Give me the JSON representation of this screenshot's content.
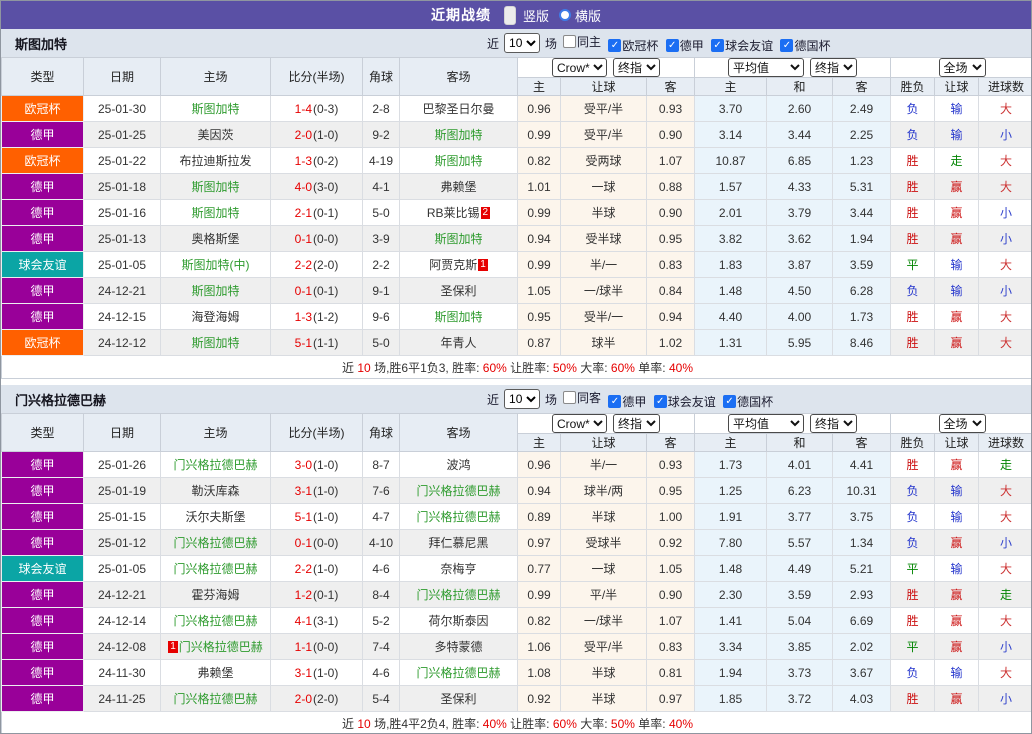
{
  "topbar": {
    "title": "近期战绩",
    "radios": [
      {
        "label": "竖版",
        "selected": true
      },
      {
        "label": "横版",
        "selected": false
      }
    ]
  },
  "table_headers": {
    "left": [
      "类型",
      "日期",
      "主场",
      "比分(半场)",
      "角球",
      "客场"
    ],
    "sub": [
      "主",
      "让球",
      "客",
      "主",
      "和",
      "客",
      "胜负",
      "让球",
      "进球数"
    ],
    "selects": {
      "odds": "Crow*",
      "odds_final": "终指",
      "avg": "平均值",
      "avg_final": "终指",
      "full": "全场"
    }
  },
  "filter_labels": {
    "near": "近",
    "unit": "场"
  },
  "result_colors": {
    "胜": "#cc1111",
    "赢": "#cc1111",
    "大": "#cc3333",
    "负": "#2233cc",
    "输": "#2233cc",
    "小": "#3344cc",
    "平": "#028402",
    "走": "#028402"
  },
  "league_colors": {
    "欧冠杯": "#ff6000",
    "德甲": "#990099",
    "球会友谊": "#0ba5a5"
  },
  "accent_colors": {
    "focus_team_green": "#2e9b2e",
    "score_red": "#e60000",
    "topbar_purple": "#5a50a5",
    "checkbox_blue": "#1b6ef3"
  },
  "sections": [
    {
      "team": "斯图加特",
      "filter": {
        "matches": "10",
        "checkboxes": [
          {
            "label": "同主",
            "checked": false
          },
          {
            "label": "欧冠杯",
            "checked": true
          },
          {
            "label": "德甲",
            "checked": true
          },
          {
            "label": "球会友谊",
            "checked": true
          },
          {
            "label": "德国杯",
            "checked": true
          }
        ]
      },
      "rows": [
        {
          "type": "欧冠杯",
          "type_color": "#ff6000",
          "date": "25-01-30",
          "home": "斯图加特",
          "home_focus": true,
          "home_card": "",
          "score": "1-4",
          "half": "(0-3)",
          "corners": "2-8",
          "away": "巴黎圣日尔曼",
          "away_focus": false,
          "away_card": "",
          "o1": "0.96",
          "line": "受平/半",
          "o2": "0.93",
          "m1": "3.70",
          "m2": "2.60",
          "m3": "2.49",
          "r1": "负",
          "r2": "输",
          "r3": "大"
        },
        {
          "type": "德甲",
          "type_color": "#990099",
          "date": "25-01-25",
          "home": "美因茨",
          "home_focus": false,
          "home_card": "",
          "score": "2-0",
          "half": "(1-0)",
          "corners": "9-2",
          "away": "斯图加特",
          "away_focus": true,
          "away_card": "",
          "o1": "0.99",
          "line": "受平/半",
          "o2": "0.90",
          "m1": "3.14",
          "m2": "3.44",
          "m3": "2.25",
          "r1": "负",
          "r2": "输",
          "r3": "小"
        },
        {
          "type": "欧冠杯",
          "type_color": "#ff6000",
          "date": "25-01-22",
          "home": "布拉迪斯拉发",
          "home_focus": false,
          "home_card": "",
          "score": "1-3",
          "half": "(0-2)",
          "corners": "4-19",
          "away": "斯图加特",
          "away_focus": true,
          "away_card": "",
          "o1": "0.82",
          "line": "受两球",
          "o2": "1.07",
          "m1": "10.87",
          "m2": "6.85",
          "m3": "1.23",
          "r1": "胜",
          "r2": "走",
          "r3": "大"
        },
        {
          "type": "德甲",
          "type_color": "#990099",
          "date": "25-01-18",
          "home": "斯图加特",
          "home_focus": true,
          "home_card": "",
          "score": "4-0",
          "half": "(3-0)",
          "corners": "4-1",
          "away": "弗赖堡",
          "away_focus": false,
          "away_card": "",
          "o1": "1.01",
          "line": "一球",
          "o2": "0.88",
          "m1": "1.57",
          "m2": "4.33",
          "m3": "5.31",
          "r1": "胜",
          "r2": "赢",
          "r3": "大"
        },
        {
          "type": "德甲",
          "type_color": "#990099",
          "date": "25-01-16",
          "home": "斯图加特",
          "home_focus": true,
          "home_card": "",
          "score": "2-1",
          "half": "(0-1)",
          "corners": "5-0",
          "away": "RB莱比锡",
          "away_focus": false,
          "away_card": "2",
          "o1": "0.99",
          "line": "半球",
          "o2": "0.90",
          "m1": "2.01",
          "m2": "3.79",
          "m3": "3.44",
          "r1": "胜",
          "r2": "赢",
          "r3": "小"
        },
        {
          "type": "德甲",
          "type_color": "#990099",
          "date": "25-01-13",
          "home": "奥格斯堡",
          "home_focus": false,
          "home_card": "",
          "score": "0-1",
          "half": "(0-0)",
          "corners": "3-9",
          "away": "斯图加特",
          "away_focus": true,
          "away_card": "",
          "o1": "0.94",
          "line": "受半球",
          "o2": "0.95",
          "m1": "3.82",
          "m2": "3.62",
          "m3": "1.94",
          "r1": "胜",
          "r2": "赢",
          "r3": "小"
        },
        {
          "type": "球会友谊",
          "type_color": "#0ba5a5",
          "date": "25-01-05",
          "home": "斯图加特(中)",
          "home_focus": true,
          "home_card": "",
          "score": "2-2",
          "half": "(2-0)",
          "corners": "2-2",
          "away": "阿贾克斯",
          "away_focus": false,
          "away_card": "1",
          "o1": "0.99",
          "line": "半/一",
          "o2": "0.83",
          "m1": "1.83",
          "m2": "3.87",
          "m3": "3.59",
          "r1": "平",
          "r2": "输",
          "r3": "大"
        },
        {
          "type": "德甲",
          "type_color": "#990099",
          "date": "24-12-21",
          "home": "斯图加特",
          "home_focus": true,
          "home_card": "",
          "score": "0-1",
          "half": "(0-1)",
          "corners": "9-1",
          "away": "圣保利",
          "away_focus": false,
          "away_card": "",
          "o1": "1.05",
          "line": "一/球半",
          "o2": "0.84",
          "m1": "1.48",
          "m2": "4.50",
          "m3": "6.28",
          "r1": "负",
          "r2": "输",
          "r3": "小"
        },
        {
          "type": "德甲",
          "type_color": "#990099",
          "date": "24-12-15",
          "home": "海登海姆",
          "home_focus": false,
          "home_card": "",
          "score": "1-3",
          "half": "(1-2)",
          "corners": "9-6",
          "away": "斯图加特",
          "away_focus": true,
          "away_card": "",
          "o1": "0.95",
          "line": "受半/一",
          "o2": "0.94",
          "m1": "4.40",
          "m2": "4.00",
          "m3": "1.73",
          "r1": "胜",
          "r2": "赢",
          "r3": "大"
        },
        {
          "type": "欧冠杯",
          "type_color": "#ff6000",
          "date": "24-12-12",
          "home": "斯图加特",
          "home_focus": true,
          "home_card": "",
          "score": "5-1",
          "half": "(1-1)",
          "corners": "5-0",
          "away": "年青人",
          "away_focus": false,
          "away_card": "",
          "o1": "0.87",
          "line": "球半",
          "o2": "1.02",
          "m1": "1.31",
          "m2": "5.95",
          "m3": "8.46",
          "r1": "胜",
          "r2": "赢",
          "r3": "大"
        }
      ],
      "summary_parts": [
        {
          "text": "近",
          "red": false
        },
        {
          "text": "10",
          "red": true
        },
        {
          "text": "场,胜6平1负3, 胜率:",
          "red": false
        },
        {
          "text": "60%",
          "red": true
        },
        {
          "text": " 让胜率:",
          "red": false
        },
        {
          "text": "50%",
          "red": true
        },
        {
          "text": " 大率:",
          "red": false
        },
        {
          "text": "60%",
          "red": true
        },
        {
          "text": " 单率:",
          "red": false
        },
        {
          "text": "40%",
          "red": true
        }
      ]
    },
    {
      "team": "门兴格拉德巴赫",
      "filter": {
        "matches": "10",
        "checkboxes": [
          {
            "label": "同客",
            "checked": false
          },
          {
            "label": "德甲",
            "checked": true
          },
          {
            "label": "球会友谊",
            "checked": true
          },
          {
            "label": "德国杯",
            "checked": true
          }
        ]
      },
      "rows": [
        {
          "type": "德甲",
          "type_color": "#990099",
          "date": "25-01-26",
          "home": "门兴格拉德巴赫",
          "home_focus": true,
          "home_card": "",
          "score": "3-0",
          "half": "(1-0)",
          "corners": "8-7",
          "away": "波鸿",
          "away_focus": false,
          "away_card": "",
          "o1": "0.96",
          "line": "半/一",
          "o2": "0.93",
          "m1": "1.73",
          "m2": "4.01",
          "m3": "4.41",
          "r1": "胜",
          "r2": "赢",
          "r3": "走"
        },
        {
          "type": "德甲",
          "type_color": "#990099",
          "date": "25-01-19",
          "home": "勒沃库森",
          "home_focus": false,
          "home_card": "",
          "score": "3-1",
          "half": "(1-0)",
          "corners": "7-6",
          "away": "门兴格拉德巴赫",
          "away_focus": true,
          "away_card": "",
          "o1": "0.94",
          "line": "球半/两",
          "o2": "0.95",
          "m1": "1.25",
          "m2": "6.23",
          "m3": "10.31",
          "r1": "负",
          "r2": "输",
          "r3": "大"
        },
        {
          "type": "德甲",
          "type_color": "#990099",
          "date": "25-01-15",
          "home": "沃尔夫斯堡",
          "home_focus": false,
          "home_card": "",
          "score": "5-1",
          "half": "(1-0)",
          "corners": "4-7",
          "away": "门兴格拉德巴赫",
          "away_focus": true,
          "away_card": "",
          "o1": "0.89",
          "line": "半球",
          "o2": "1.00",
          "m1": "1.91",
          "m2": "3.77",
          "m3": "3.75",
          "r1": "负",
          "r2": "输",
          "r3": "大"
        },
        {
          "type": "德甲",
          "type_color": "#990099",
          "date": "25-01-12",
          "home": "门兴格拉德巴赫",
          "home_focus": true,
          "home_card": "",
          "score": "0-1",
          "half": "(0-0)",
          "corners": "4-10",
          "away": "拜仁慕尼黑",
          "away_focus": false,
          "away_card": "",
          "o1": "0.97",
          "line": "受球半",
          "o2": "0.92",
          "m1": "7.80",
          "m2": "5.57",
          "m3": "1.34",
          "r1": "负",
          "r2": "赢",
          "r3": "小"
        },
        {
          "type": "球会友谊",
          "type_color": "#0ba5a5",
          "date": "25-01-05",
          "home": "门兴格拉德巴赫",
          "home_focus": true,
          "home_card": "",
          "score": "2-2",
          "half": "(1-0)",
          "corners": "4-6",
          "away": "奈梅亨",
          "away_focus": false,
          "away_card": "",
          "o1": "0.77",
          "line": "一球",
          "o2": "1.05",
          "m1": "1.48",
          "m2": "4.49",
          "m3": "5.21",
          "r1": "平",
          "r2": "输",
          "r3": "大"
        },
        {
          "type": "德甲",
          "type_color": "#990099",
          "date": "24-12-21",
          "home": "霍芬海姆",
          "home_focus": false,
          "home_card": "",
          "score": "1-2",
          "half": "(0-1)",
          "corners": "8-4",
          "away": "门兴格拉德巴赫",
          "away_focus": true,
          "away_card": "",
          "o1": "0.99",
          "line": "平/半",
          "o2": "0.90",
          "m1": "2.30",
          "m2": "3.59",
          "m3": "2.93",
          "r1": "胜",
          "r2": "赢",
          "r3": "走"
        },
        {
          "type": "德甲",
          "type_color": "#990099",
          "date": "24-12-14",
          "home": "门兴格拉德巴赫",
          "home_focus": true,
          "home_card": "",
          "score": "4-1",
          "half": "(3-1)",
          "corners": "5-2",
          "away": "荷尔斯泰因",
          "away_focus": false,
          "away_card": "",
          "o1": "0.82",
          "line": "一/球半",
          "o2": "1.07",
          "m1": "1.41",
          "m2": "5.04",
          "m3": "6.69",
          "r1": "胜",
          "r2": "赢",
          "r3": "大"
        },
        {
          "type": "德甲",
          "type_color": "#990099",
          "date": "24-12-08",
          "home": "门兴格拉德巴赫",
          "home_focus": true,
          "home_card": "1",
          "score": "1-1",
          "half": "(0-0)",
          "corners": "7-4",
          "away": "多特蒙德",
          "away_focus": false,
          "away_card": "",
          "o1": "1.06",
          "line": "受平/半",
          "o2": "0.83",
          "m1": "3.34",
          "m2": "3.85",
          "m3": "2.02",
          "r1": "平",
          "r2": "赢",
          "r3": "小"
        },
        {
          "type": "德甲",
          "type_color": "#990099",
          "date": "24-11-30",
          "home": "弗赖堡",
          "home_focus": false,
          "home_card": "",
          "score": "3-1",
          "half": "(1-0)",
          "corners": "4-6",
          "away": "门兴格拉德巴赫",
          "away_focus": true,
          "away_card": "",
          "o1": "1.08",
          "line": "半球",
          "o2": "0.81",
          "m1": "1.94",
          "m2": "3.73",
          "m3": "3.67",
          "r1": "负",
          "r2": "输",
          "r3": "大"
        },
        {
          "type": "德甲",
          "type_color": "#990099",
          "date": "24-11-25",
          "home": "门兴格拉德巴赫",
          "home_focus": true,
          "home_card": "",
          "score": "2-0",
          "half": "(2-0)",
          "corners": "5-4",
          "away": "圣保利",
          "away_focus": false,
          "away_card": "",
          "o1": "0.92",
          "line": "半球",
          "o2": "0.97",
          "m1": "1.85",
          "m2": "3.72",
          "m3": "4.03",
          "r1": "胜",
          "r2": "赢",
          "r3": "小"
        }
      ],
      "summary_parts": [
        {
          "text": "近",
          "red": false
        },
        {
          "text": "10",
          "red": true
        },
        {
          "text": "场,胜4平2负4, 胜率:",
          "red": false
        },
        {
          "text": "40%",
          "red": true
        },
        {
          "text": " 让胜率:",
          "red": false
        },
        {
          "text": "60%",
          "red": true
        },
        {
          "text": " 大率:",
          "red": false
        },
        {
          "text": "50%",
          "red": true
        },
        {
          "text": " 单率:",
          "red": false
        },
        {
          "text": "40%",
          "red": true
        }
      ]
    }
  ]
}
